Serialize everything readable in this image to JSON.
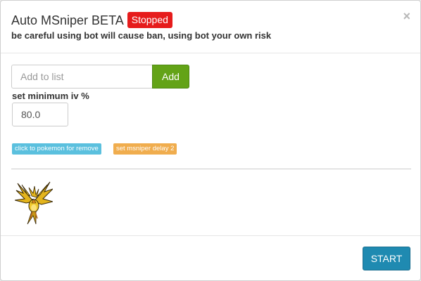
{
  "header": {
    "title": "Auto MSniper BETA",
    "status": "Stopped",
    "warning": "be careful using bot will cause ban, using bot your own risk",
    "close_symbol": "×"
  },
  "add_list": {
    "placeholder": "Add to list",
    "value": "",
    "button_label": "Add"
  },
  "min_iv": {
    "label": "set minimum iv %",
    "value": "80.0"
  },
  "tags": {
    "remove_hint": "click to pokemon for remove",
    "delay": "set msniper delay 2"
  },
  "pokemon_list": [
    {
      "icon": "zapdos-icon"
    }
  ],
  "footer": {
    "start_label": "START"
  },
  "colors": {
    "status_badge": "#e61c1c",
    "add_button": "#63a317",
    "tag_info": "#5bc0de",
    "tag_warning": "#f0ad4e",
    "start_button": "#1f8ab1"
  }
}
